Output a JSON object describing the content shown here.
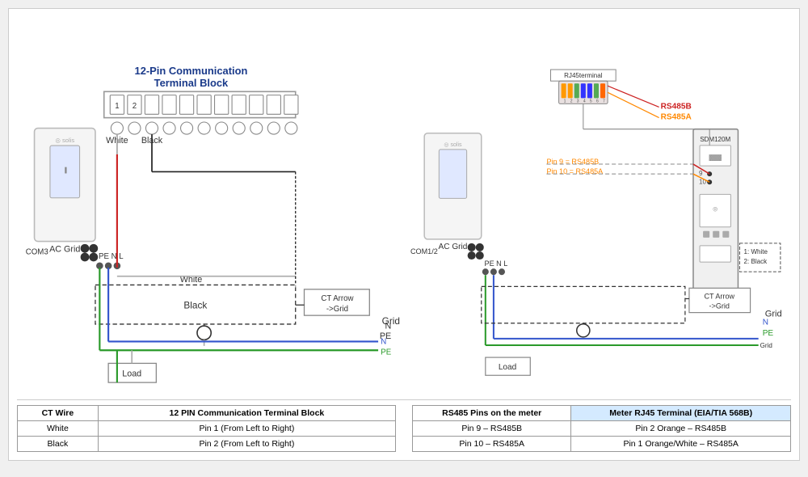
{
  "left_diagram": {
    "title": "12-Pin Communication Terminal Block",
    "labels": {
      "com3": "COM3",
      "pe_n_l": "PE N L",
      "ac_grid": "AC Grid",
      "white_wire": "White",
      "black_wire": "Black",
      "ct_arrow": "CT Arrow\n->Grid",
      "grid": "Grid",
      "n_label": "N",
      "pe_label": "PE",
      "load": "Load",
      "white_top": "White",
      "black_top": "Black"
    }
  },
  "right_diagram": {
    "labels": {
      "rj45_terminal": "RJ45terminal",
      "rs485b": "RS485B",
      "rs485a": "RS485A",
      "pin9": "Pin 9 = RS485B",
      "pin10": "Pin 10 = RS485A",
      "sdm120m": "SDM120M",
      "com1_2": "COM1/2",
      "pe_n_l": "PE N L",
      "ac_grid": "AC Grid",
      "ct_arrow": "CT Arrow\n->Grid",
      "grid": "Grid",
      "n_label": "N",
      "pe_label": "PE",
      "load": "Load",
      "white_1": "1: White",
      "black_2": "2: Black"
    }
  },
  "table_left": {
    "col1_header": "CT Wire",
    "col2_header": "12 PIN Communication Terminal Block",
    "rows": [
      {
        "ct": "White",
        "pin": "Pin 1 (From Left to Right)"
      },
      {
        "ct": "Black",
        "pin": "Pin 2 (From Left to Right)"
      }
    ]
  },
  "table_right": {
    "col1_header": "RS485 Pins on the meter",
    "col2_header": "Meter RJ45 Terminal (EIA/TIA 568B)",
    "rows": [
      {
        "pin": "Pin 9 – RS485B",
        "rj": "Pin 2 Orange – RS485B"
      },
      {
        "pin": "Pin 10 – RS485A",
        "rj": "Pin 1 Orange/White – RS485A"
      }
    ]
  }
}
